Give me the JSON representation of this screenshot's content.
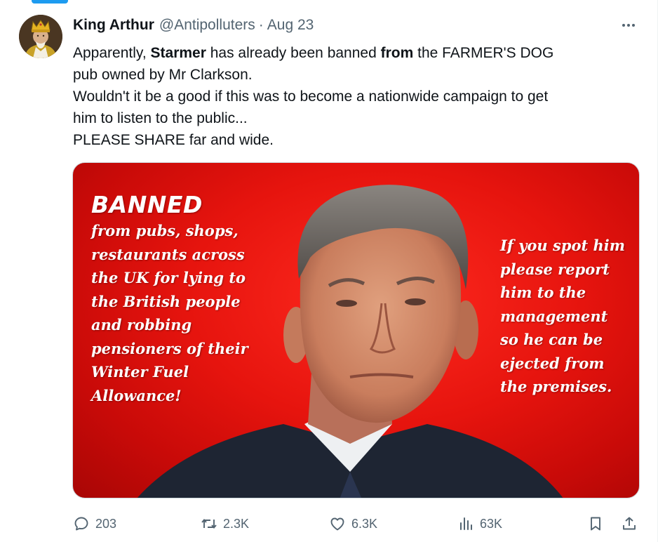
{
  "tweet": {
    "author": {
      "display_name": "King Arthur",
      "handle": "@Antipolluters",
      "separator": "·",
      "date": "Aug 23"
    },
    "text": {
      "line1_pre": "Apparently, ",
      "line1_bold1": "Starmer",
      "line1_mid": " has already been banned ",
      "line1_bold2": "from",
      "line1_post": " the FARMER'S DOG",
      "line2": "pub owned by Mr Clarkson.",
      "line3": "Wouldn't it be a good if this was to become a nationwide campaign to get",
      "line4": "him to listen to the public...",
      "line5": "PLEASE SHARE far and wide."
    },
    "media": {
      "heading": "BANNED",
      "left_lines": [
        "from pubs, shops,",
        "restaurants across",
        "the UK for lying to",
        "the British people",
        "and robbing",
        "pensioners of their",
        "Winter Fuel",
        "Allowance!"
      ],
      "right_lines": [
        "If you spot him",
        "please report",
        "him to the",
        "management",
        "so he can be",
        "ejected from",
        "the premises."
      ],
      "background_color": "#e6140e"
    },
    "actions": {
      "replies": "203",
      "retweets": "2.3K",
      "likes": "6.3K",
      "views": "63K"
    }
  },
  "colors": {
    "text_primary": "#0f1419",
    "text_secondary": "#536471",
    "accent": "#1d9bf0"
  },
  "icons": [
    "more-icon",
    "reply-icon",
    "retweet-icon",
    "like-icon",
    "views-icon",
    "bookmark-icon",
    "share-icon"
  ]
}
